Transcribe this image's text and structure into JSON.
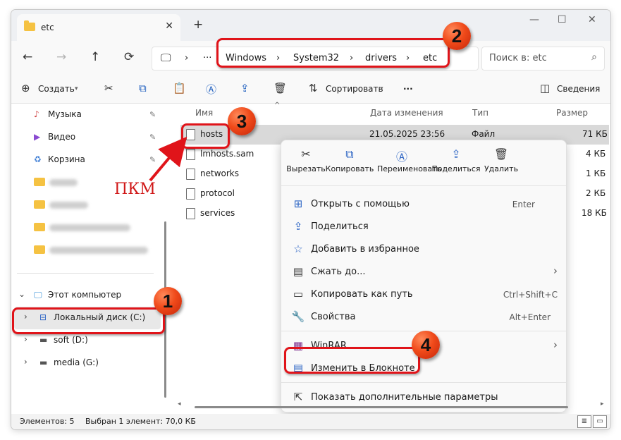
{
  "window": {
    "tab_title": "etc",
    "new_tab": "+",
    "controls": {
      "minimize": "—",
      "maximize": "☐",
      "close": "✕"
    }
  },
  "nav": {
    "back": "←",
    "forward": "→",
    "up": "↑",
    "refresh": "⟳",
    "pc_icon": "🖵",
    "chevron": "›",
    "more": "···",
    "breadcrumb": [
      "Windows",
      "System32",
      "drivers",
      "etc"
    ],
    "search_placeholder": "Поиск в: etc",
    "search_icon": "⌕"
  },
  "toolbar": {
    "create": "Создать",
    "sort": "Сортировать",
    "more": "···",
    "details": "Сведения"
  },
  "sidebar": {
    "quick": [
      {
        "label": "Музыка",
        "icon": "music-icon",
        "glyph": "♪",
        "color": "#d14a4a"
      },
      {
        "label": "Видео",
        "icon": "video-icon",
        "glyph": "▶",
        "color": "#8a4ad1"
      },
      {
        "label": "Корзина",
        "icon": "recycle-bin-icon",
        "glyph": "♻",
        "color": "#3a7bd5"
      }
    ],
    "pin": "📌",
    "this_pc": "Этот компьютер",
    "drives": [
      {
        "label": "Локальный диск (C:)"
      },
      {
        "label": "soft (D:)"
      },
      {
        "label": "media (G:)"
      }
    ]
  },
  "files": {
    "columns": {
      "name": "Имя",
      "date": "Дата изменения",
      "type": "Тип",
      "size": "Размер"
    },
    "rows": [
      {
        "name": "hosts",
        "date": "21.05.2025 23:56",
        "type": "Файл",
        "size": "71 КБ"
      },
      {
        "name": "lmhosts.sam",
        "size": "4 КБ"
      },
      {
        "name": "networks",
        "size": "1 КБ"
      },
      {
        "name": "protocol",
        "size": "2 КБ"
      },
      {
        "name": "services",
        "size": "18 КБ"
      }
    ]
  },
  "context_menu": {
    "quick_actions": [
      {
        "label": "Вырезать",
        "glyph": "✂"
      },
      {
        "label": "Копировать",
        "glyph": "⧉"
      },
      {
        "label": "Переименовать",
        "glyph": "Ⓐ"
      },
      {
        "label": "Поделиться",
        "glyph": "⇪"
      },
      {
        "label": "Удалить",
        "glyph": "🗑"
      }
    ],
    "items": [
      {
        "label": "Открыть с помощью",
        "shortcut": "Enter",
        "glyph": "⊞"
      },
      {
        "label": "Поделиться",
        "shortcut": "",
        "glyph": "⇪"
      },
      {
        "label": "Добавить в избранное",
        "shortcut": "",
        "glyph": "☆"
      },
      {
        "label": "Сжать до...",
        "shortcut": "›",
        "glyph": "▤"
      },
      {
        "label": "Копировать как путь",
        "shortcut": "Ctrl+Shift+C",
        "glyph": "▭"
      },
      {
        "label": "Свойства",
        "shortcut": "Alt+Enter",
        "glyph": "🔧"
      },
      {
        "label": "WinRAR",
        "shortcut": "›",
        "glyph": "▦"
      },
      {
        "label": "Изменить в Блокноте",
        "shortcut": "",
        "glyph": "▤"
      },
      {
        "label": "Показать дополнительные параметры",
        "shortcut": "",
        "glyph": "⇱"
      }
    ]
  },
  "status": {
    "items": "Элементов: 5",
    "selected": "Выбран 1 элемент: 70,0 КБ"
  },
  "annotations": {
    "pkm": "ПКМ",
    "badges": [
      "1",
      "2",
      "3",
      "4"
    ],
    "color": "#e0141a"
  }
}
